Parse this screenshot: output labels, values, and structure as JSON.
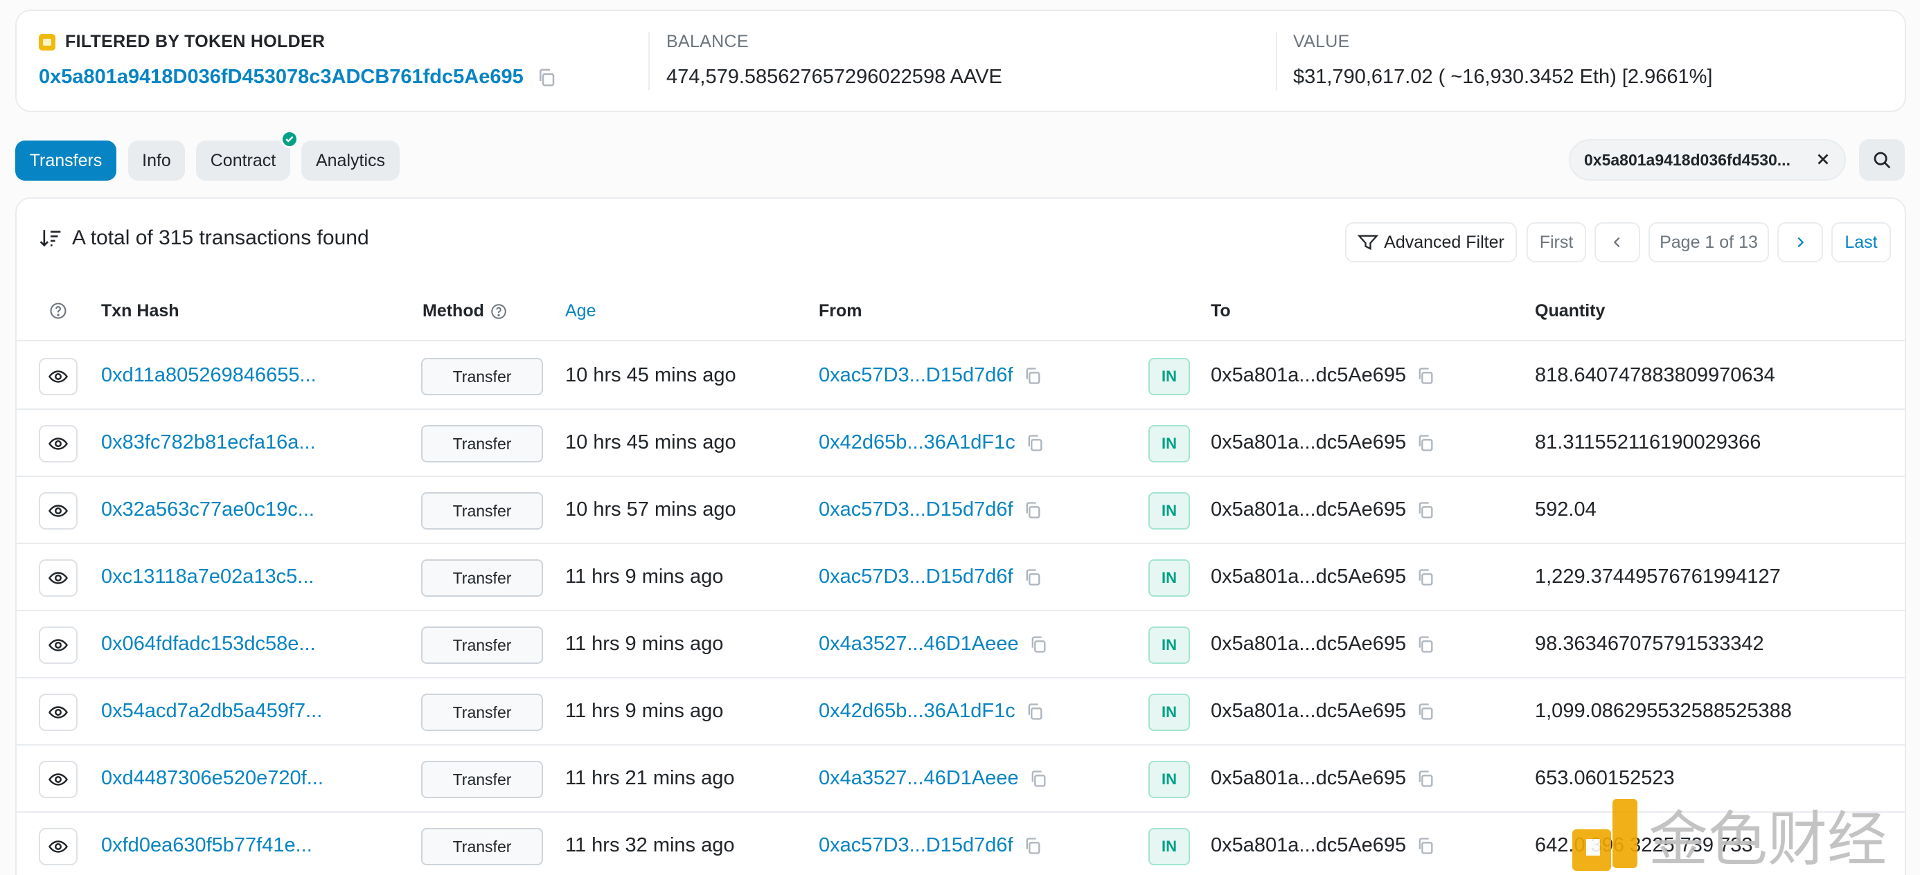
{
  "summary": {
    "filtered_label": "FILTERED BY TOKEN HOLDER",
    "holder_address": "0x5a801a9418D036fD453078c3ADCB761fdc5Ae695",
    "balance_label": "BALANCE",
    "balance_value": "474,579.585627657296022598 AAVE",
    "value_label": "VALUE",
    "value_value": "$31,790,617.02 ( ~16,930.3452 Eth) [2.9661%]"
  },
  "tabs": [
    {
      "label": "Transfers",
      "active": true
    },
    {
      "label": "Info",
      "active": false
    },
    {
      "label": "Contract",
      "active": false,
      "verified": true
    },
    {
      "label": "Analytics",
      "active": false
    }
  ],
  "filter_pill": {
    "text": "0x5a801a9418d036fd4530..."
  },
  "table": {
    "total_text": "A total of 315 transactions found",
    "advanced_filter_label": "Advanced Filter",
    "pagination": {
      "first": "First",
      "page_text": "Page 1 of 13",
      "last": "Last"
    },
    "headers": {
      "txn_hash": "Txn Hash",
      "method": "Method",
      "age": "Age",
      "from": "From",
      "to": "To",
      "quantity": "Quantity"
    },
    "rows": [
      {
        "hash": "0xd11a805269846655...",
        "method": "Transfer",
        "age": "10 hrs 45 mins ago",
        "from": "0xac57D3...D15d7d6f",
        "direction": "IN",
        "to": "0x5a801a...dc5Ae695",
        "quantity": "818.640747883809970634"
      },
      {
        "hash": "0x83fc782b81ecfa16a...",
        "method": "Transfer",
        "age": "10 hrs 45 mins ago",
        "from": "0x42d65b...36A1dF1c",
        "direction": "IN",
        "to": "0x5a801a...dc5Ae695",
        "quantity": "81.311552116190029366"
      },
      {
        "hash": "0x32a563c77ae0c19c...",
        "method": "Transfer",
        "age": "10 hrs 57 mins ago",
        "from": "0xac57D3...D15d7d6f",
        "direction": "IN",
        "to": "0x5a801a...dc5Ae695",
        "quantity": "592.04"
      },
      {
        "hash": "0xc13118a7e02a13c5...",
        "method": "Transfer",
        "age": "11 hrs 9 mins ago",
        "from": "0xac57D3...D15d7d6f",
        "direction": "IN",
        "to": "0x5a801a...dc5Ae695",
        "quantity": "1,229.37449576761994127"
      },
      {
        "hash": "0x064fdfadc153dc58e...",
        "method": "Transfer",
        "age": "11 hrs 9 mins ago",
        "from": "0x4a3527...46D1Aeee",
        "direction": "IN",
        "to": "0x5a801a...dc5Ae695",
        "quantity": "98.363467075791533342"
      },
      {
        "hash": "0x54acd7a2db5a459f7...",
        "method": "Transfer",
        "age": "11 hrs 9 mins ago",
        "from": "0x42d65b...36A1dF1c",
        "direction": "IN",
        "to": "0x5a801a...dc5Ae695",
        "quantity": "1,099.086295532588525388"
      },
      {
        "hash": "0xd4487306e520e720f...",
        "method": "Transfer",
        "age": "11 hrs 21 mins ago",
        "from": "0x4a3527...46D1Aeee",
        "direction": "IN",
        "to": "0x5a801a...dc5Ae695",
        "quantity": "653.060152523"
      },
      {
        "hash": "0xfd0ea630f5b77f41e...",
        "method": "Transfer",
        "age": "11 hrs 32 mins ago",
        "from": "0xac57D3...D15d7d6f",
        "direction": "IN",
        "to": "0x5a801a...dc5Ae695",
        "quantity": "642.0  396  3225  739  733"
      }
    ]
  },
  "colors": {
    "accent": "#0784c3",
    "in_badge": "#00a186",
    "border": "#e9ecef"
  },
  "watermark": {
    "text": "金色财经"
  }
}
